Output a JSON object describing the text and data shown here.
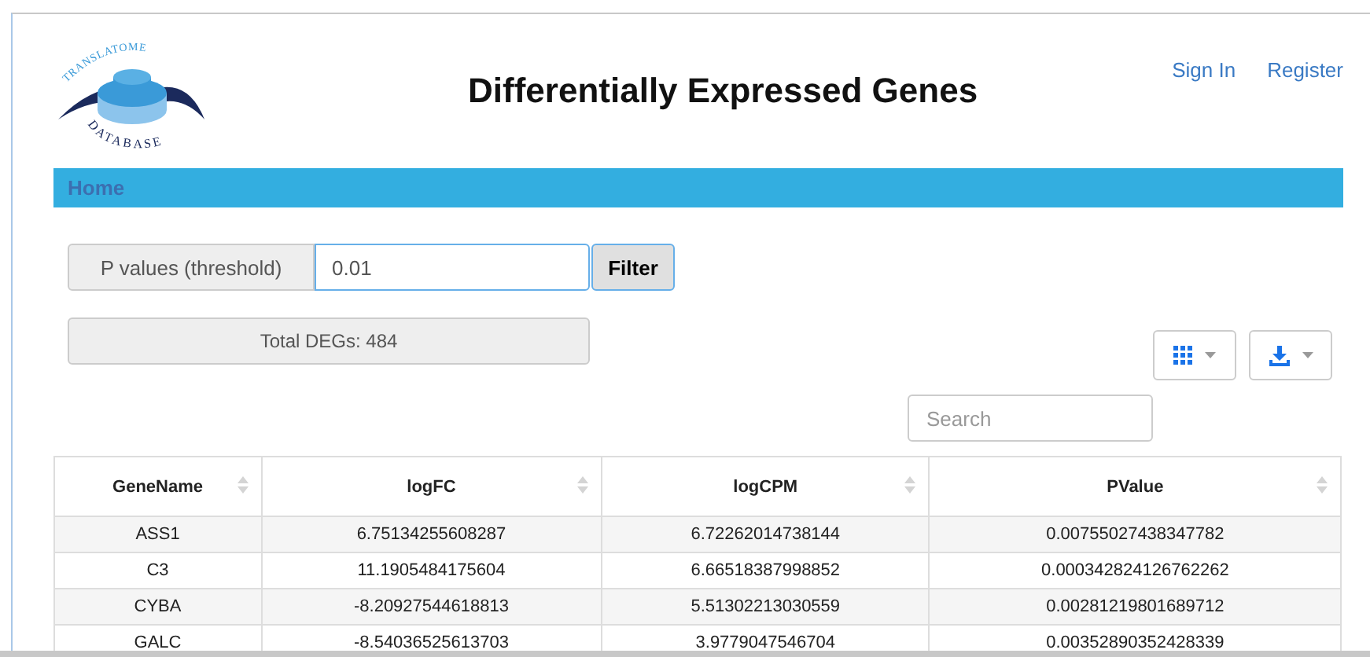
{
  "logo": {
    "top_text": "TRANSLATOME",
    "bottom_text": "DATABASE"
  },
  "title": "Differentially Expressed Genes",
  "auth_links": [
    "Sign In",
    "Register"
  ],
  "nav": {
    "items": [
      {
        "label": "Home",
        "selected": true
      }
    ]
  },
  "filter": {
    "label": "P values (threshold)",
    "value": "0.01",
    "button": "Filter"
  },
  "total": "Total DEGs: 484",
  "search": {
    "placeholder": "Search"
  },
  "table": {
    "columns": [
      "GeneName",
      "logFC",
      "logCPM",
      "PValue"
    ],
    "rows": [
      [
        "ASS1",
        "6.75134255608287",
        "6.72262014738144",
        "0.00755027438347782"
      ],
      [
        "C3",
        "11.1905484175604",
        "6.66518387998852",
        "0.000342824126762262"
      ],
      [
        "CYBA",
        "-8.20927544618813",
        "5.51302213030559",
        "0.00281219801689712"
      ],
      [
        "GALC",
        "-8.54036525613703",
        "3.9779047546704",
        "0.00352890352428339"
      ]
    ]
  }
}
